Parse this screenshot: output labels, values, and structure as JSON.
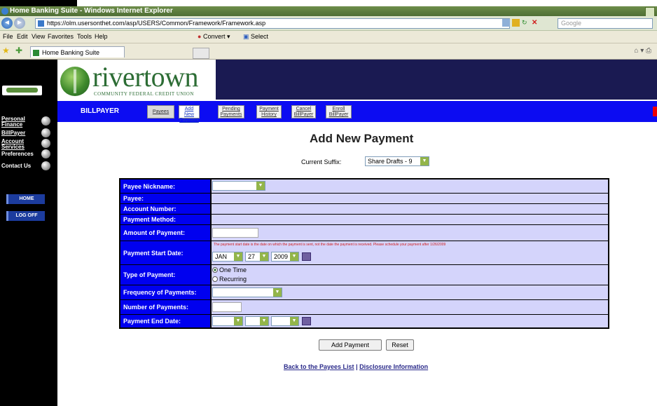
{
  "browser": {
    "title": "Home Banking Suite - Windows Internet Explorer",
    "address": "https://olm.usersonthet.com/asp/USERS/Common/Framework/Framework.asp",
    "search_placeholder": "Google",
    "menu": [
      "File",
      "Edit",
      "View",
      "Favorites",
      "Tools",
      "Help"
    ],
    "convert_label": "Convert",
    "select_label": "Select",
    "tab_label": "Home Banking Suite"
  },
  "brand": {
    "name": "rivertown",
    "tagline": "COMMUNITY FEDERAL CREDIT UNION",
    "colors": {
      "green": "#2d6d35",
      "navy": "#1a1a52",
      "blue": "#0c0cf2"
    }
  },
  "sidebar": {
    "items": [
      {
        "label": "Personal Finance"
      },
      {
        "label": "BillPayer"
      },
      {
        "label": "Account Services"
      },
      {
        "label": "Preferences"
      },
      {
        "label": "Contact Us"
      }
    ],
    "home_label": "HOME",
    "logoff_label": "LOG OFF"
  },
  "billpayer": {
    "section": "BILLPAYER",
    "tabs": [
      {
        "label": "Payees"
      },
      {
        "label": "Add New Payment"
      },
      {
        "label": "Pending Payments"
      },
      {
        "label": "Payment History"
      },
      {
        "label": "Cancel BillPayer"
      },
      {
        "label": "Enroll BillPayer"
      }
    ]
  },
  "page": {
    "title": "Add New Payment",
    "suffix_label": "Current Suffix:",
    "suffix_value": "Share Drafts - 9"
  },
  "form": {
    "payee_nickname": "Payee Nickname:",
    "payee": "Payee:",
    "account_number": "Account Number:",
    "payment_method": "Payment Method:",
    "amount": "Amount of Payment:",
    "start_date": "Payment Start Date:",
    "start_note": "The payment start date is the date on which the payment is sent, not the date the payment is received. Please schedule your payment after 1/26/2009",
    "start_month": "JAN",
    "start_day": "27",
    "start_year": "2009",
    "type": "Type of Payment:",
    "type_options": [
      "One Time",
      "Recurring"
    ],
    "frequency": "Frequency of Payments:",
    "number": "Number of Payments:",
    "end_date": "Payment End Date:"
  },
  "actions": {
    "add": "Add Payment",
    "reset": "Reset"
  },
  "links": {
    "back": "Back to the Payees List",
    "separator": "|",
    "disclosure": "Disclosure Information"
  }
}
